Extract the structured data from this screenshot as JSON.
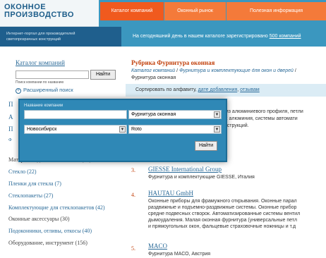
{
  "header": {
    "logo_line1": "ОКОННОЕ",
    "logo_line2": "ПРОИЗВОДСТВО",
    "tagline_line1": "Интернет-портал для производителей",
    "tagline_line2": "светопрозрачных конструкций",
    "tabs": [
      {
        "label": "Каталог компаний"
      },
      {
        "label": "Оконный рынок"
      },
      {
        "label": "Полезная информация"
      }
    ],
    "notice_text": "На сегодняшний день в нашем каталоге зарегистрировано",
    "notice_link": "500 компаний"
  },
  "sidebar": {
    "catalog_title": "Каталог компаний",
    "search_value": "",
    "find_button": "Найти",
    "search_hint": "Поиск компании по названию",
    "advanced_search": "Расширенный поиск",
    "items": [
      {
        "label": "Материалы для монтажа окон (62)"
      },
      {
        "label": "Стекло (22)"
      },
      {
        "label": "Пленки для стекла (7)"
      },
      {
        "label": "Стеклопакеты (27)"
      },
      {
        "label": "Комплектующие для стеклопакетов (42)"
      },
      {
        "label": "Оконные аксессуары (30)"
      },
      {
        "label": "Подоконники, отливы, откосы (40)"
      },
      {
        "label": "Оборудование, инструмент (156)"
      }
    ],
    "frag_letters": [
      "П",
      "А",
      "П",
      "Ф"
    ]
  },
  "main": {
    "rubric": "Рубрика Фурнитура оконная",
    "breadcrumbs": [
      {
        "label": "Каталог компаний"
      },
      {
        "label": "Фурнитура и комплектующие для окон и дверей"
      }
    ],
    "current": "Фурнитура оконная",
    "sort_label": "Сортировать по алфавиту,",
    "sort_links": [
      "дате добавления",
      "отзывам"
    ],
    "frag_lines": [
      "и из алюминиевого профиля, петли",
      "ых алюминия, системы автомати",
      "онструкций."
    ],
    "entries": [
      {
        "num": "3.",
        "title": "GIESSE International Group",
        "lines": [
          "Фурнитура и комплектующие GIESSE, Италия"
        ]
      },
      {
        "num": "4.",
        "title": "HAUTAU GmbH",
        "lines": [
          "Оконные приборы для фрамужного открывания. Оконные парал",
          "раздвижные и подъемно-раздвижные системы. Оконные прибор",
          "средне подвесных створок. Автоматизированные системы вентил",
          "дымоудаления. Малая оконная фурнитура (универсальные петл",
          "и прямоугольных окон, фальцевые страховочные ножницы и т.д"
        ]
      },
      {
        "num": "5.",
        "title": "MACO",
        "lines": [
          "Фурнитура МАСО, Австрия"
        ]
      }
    ]
  },
  "popup": {
    "label": "Название компании",
    "name_value": "",
    "category_value": "Фурнитура оконная",
    "city_value": "Новосибирск",
    "brand_value": "Roto",
    "submit_label": "Найти"
  },
  "colors": {
    "header_blue": "#3b97bf",
    "dark_blue": "#1f5f8d",
    "orange_tab": "#f05a1e",
    "link_blue": "#2a6a98",
    "rubric_orange": "#c2410c"
  }
}
